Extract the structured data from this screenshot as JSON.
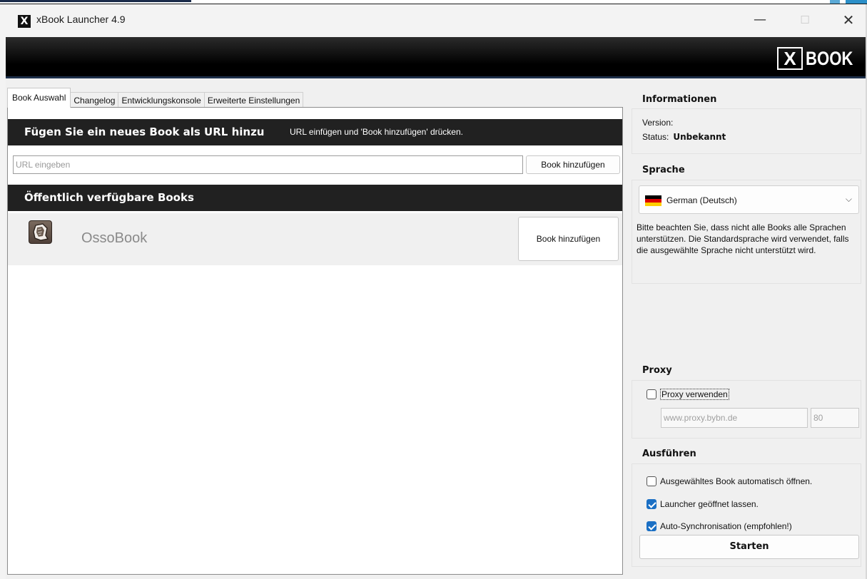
{
  "window": {
    "title": "xBook Launcher 4.9",
    "app_icon_glyph": "X",
    "minimize_glyph": "—",
    "maximize_glyph": "☐",
    "close_glyph": "✕"
  },
  "banner": {
    "logo_x": "X",
    "logo_text": "BOOK"
  },
  "tabs": [
    {
      "label": "Book Auswahl",
      "active": true
    },
    {
      "label": "Changelog",
      "active": false
    },
    {
      "label": "Entwicklungskonsole",
      "active": false
    },
    {
      "label": "Erweiterte Einstellungen",
      "active": false
    }
  ],
  "add_url": {
    "title": "Fügen Sie ein neues Book als URL hinzu",
    "hint": "URL einfügen und 'Book hinzufügen' drücken.",
    "input_placeholder": "URL eingeben",
    "button_label": "Book hinzufügen"
  },
  "public_books": {
    "title": "Öffentlich verfügbare Books",
    "items": [
      {
        "name": "OssoBook",
        "icon": "ossobook-icon",
        "button_label": "Book hinzufügen"
      }
    ]
  },
  "info": {
    "heading": "Informationen",
    "version_label": "Version:",
    "version_value": "",
    "status_label": "Status:",
    "status_value": "Unbekannt"
  },
  "language": {
    "heading": "Sprache",
    "selected": "German (Deutsch)",
    "note": "Bitte beachten Sie, dass nicht alle Books alle Sprachen unterstützen. Die Standardsprache wird verwendet, falls die ausgewählte Sprache nicht unterstützt wird."
  },
  "proxy": {
    "heading": "Proxy",
    "use_proxy_label": "Proxy verwenden",
    "use_proxy_checked": false,
    "host_placeholder": "www.proxy.bybn.de",
    "port_placeholder": "80"
  },
  "run": {
    "heading": "Ausführen",
    "options": [
      {
        "label": "Ausgewähltes Book automatisch öffnen.",
        "checked": false
      },
      {
        "label": "Launcher geöffnet lassen.",
        "checked": true
      },
      {
        "label": "Auto-Synchronisation (empfohlen!)",
        "checked": true
      }
    ],
    "start_label": "Starten"
  },
  "colors": {
    "banner_bg": "#000000",
    "header_bar_bg": "#212121",
    "checkbox_accent": "#1a6fc4",
    "flag": [
      "#000000",
      "#dd0000",
      "#ffce00"
    ]
  }
}
